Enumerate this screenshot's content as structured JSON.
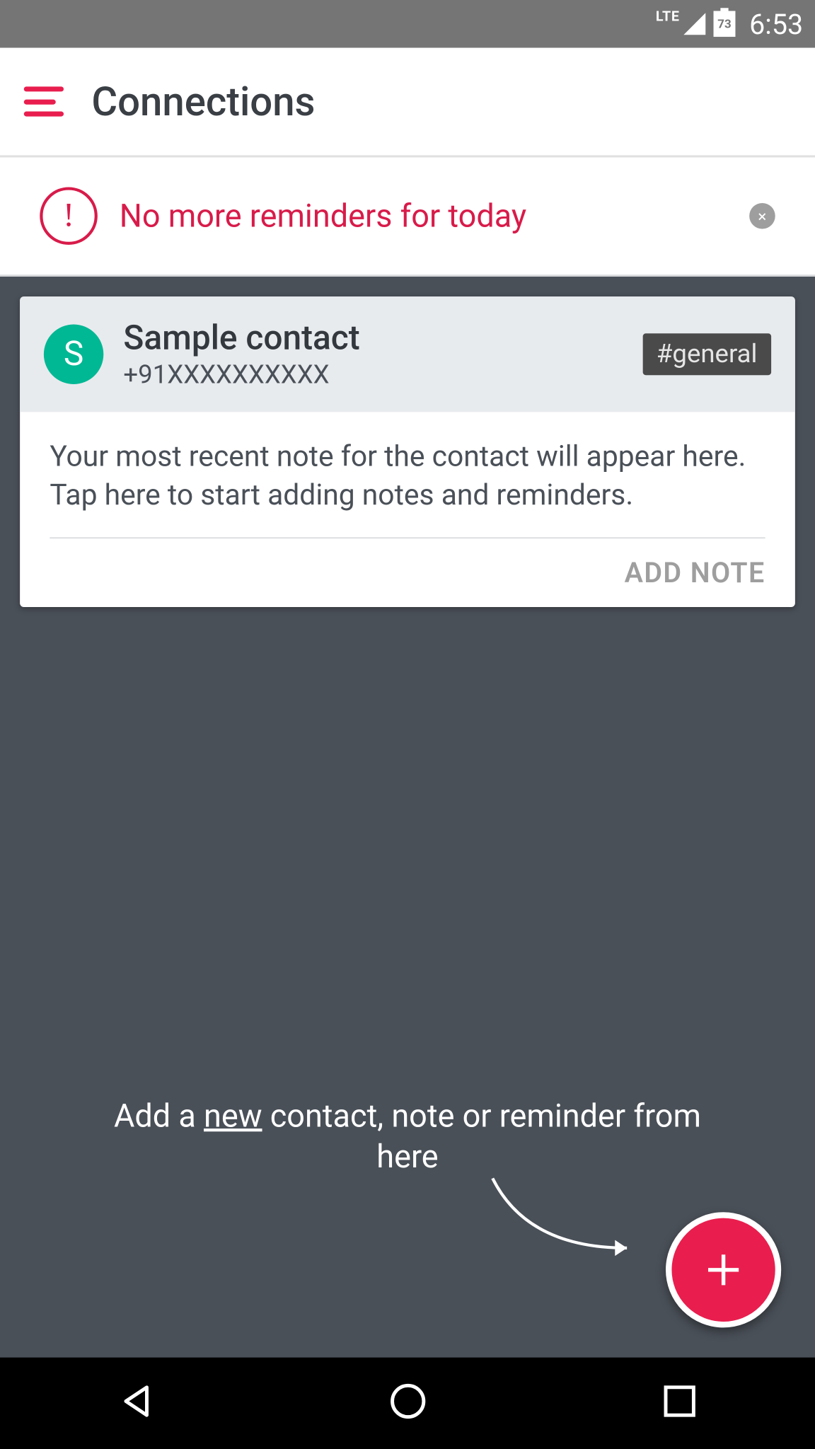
{
  "status": {
    "network": "LTE",
    "battery": "73",
    "time": "6:53"
  },
  "appbar": {
    "title": "Connections"
  },
  "banner": {
    "text": "No more reminders for today",
    "exclaim": "!"
  },
  "card": {
    "avatar_initial": "S",
    "name": "Sample contact",
    "phone": "+91XXXXXXXXXX",
    "tag": "#general",
    "note": "Your most recent note for the contact will appear here. Tap here to start adding notes and reminders.",
    "add_note_label": "ADD NOTE"
  },
  "hint": {
    "pre": "Add a ",
    "underlined": "new",
    "post": " contact, note or reminder from here"
  }
}
